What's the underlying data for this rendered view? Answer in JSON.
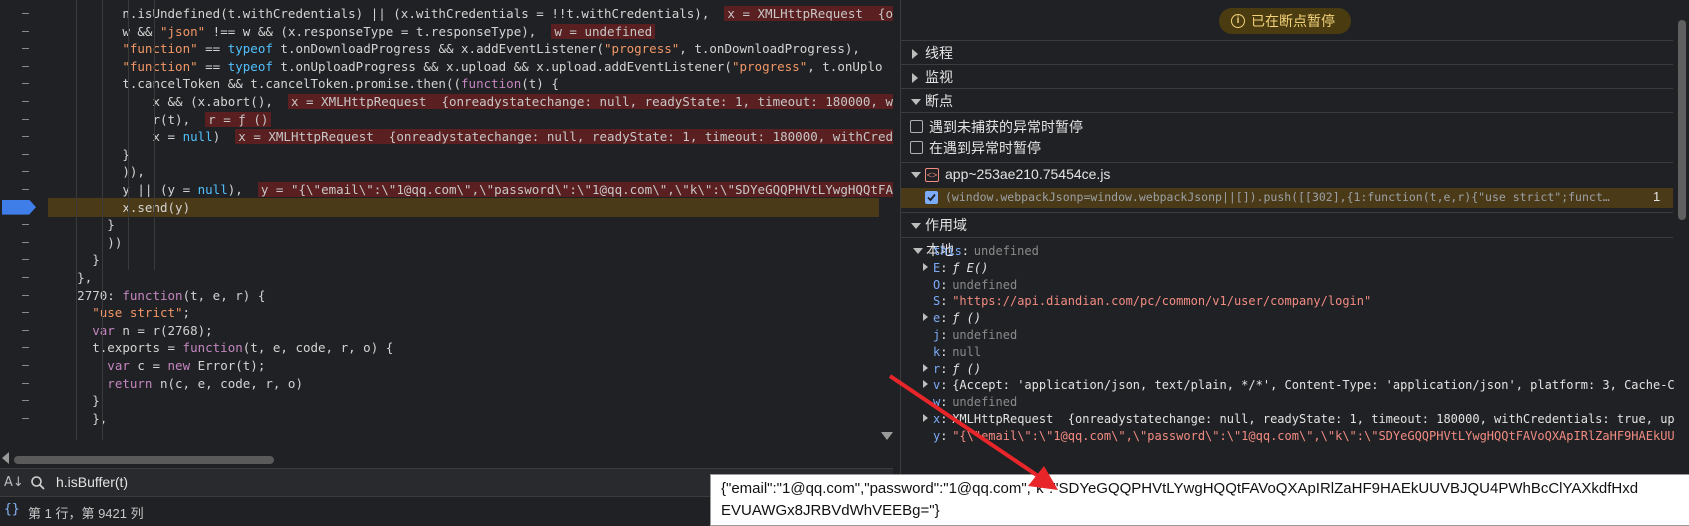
{
  "editor": {
    "lines": [
      {
        "indent": 6,
        "html": false,
        "code": "n.isUndefined(t.withCredentials) || (x.withCredentials = !!t.withCredentials),",
        "inline": "x = XMLHttpRequest  {o"
      },
      {
        "indent": 6,
        "code": "w && \"json\" !== w && (x.responseType = t.responseType),",
        "inline": "w = undefined"
      },
      {
        "indent": 6,
        "code": "\"function\" == typeof t.onDownloadProgress && x.addEventListener(\"progress\", t.onDownloadProgress),",
        "inline": ""
      },
      {
        "indent": 6,
        "code": "\"function\" == typeof t.onUploadProgress && x.upload && x.upload.addEventListener(\"progress\", t.onUplo",
        "inline": ""
      },
      {
        "indent": 6,
        "code": "t.cancelToken && t.cancelToken.promise.then((function(t) {",
        "inline": ""
      },
      {
        "indent": 8,
        "code": "x && (x.abort(),",
        "inline": "x = XMLHttpRequest  {onreadystatechange: null, readyState: 1, timeout: 180000, w"
      },
      {
        "indent": 8,
        "code": "r(t),",
        "inline": "r = ƒ ()"
      },
      {
        "indent": 8,
        "code": "x = null)",
        "inline": "x = XMLHttpRequest  {onreadystatechange: null, readyState: 1, timeout: 180000, withCred"
      },
      {
        "indent": 6,
        "code": "}",
        "inline": ""
      },
      {
        "indent": 6,
        "code": ")),",
        "inline": ""
      },
      {
        "indent": 6,
        "code": "y || (y = null),",
        "inline": "y = \"{\\\"email\\\":\\\"1@qq.com\\\",\\\"password\\\":\\\"1@qq.com\\\",\\\"k\\\":\\\"SDYeGQQPHVtLYwgHQQtFA"
      },
      {
        "indent": 6,
        "code": "x.send(y)",
        "inline": "",
        "current": true
      },
      {
        "indent": 5,
        "code": "}",
        "inline": ""
      },
      {
        "indent": 5,
        "code": "))",
        "inline": ""
      },
      {
        "indent": 4,
        "code": "}",
        "inline": ""
      },
      {
        "indent": 3,
        "code": "},",
        "inline": ""
      },
      {
        "indent": 3,
        "code": "2770: function(t, e, r) {",
        "inline": ""
      },
      {
        "indent": 4,
        "code": "\"use strict\";",
        "inline": ""
      },
      {
        "indent": 4,
        "code": "var n = r(2768);",
        "inline": ""
      },
      {
        "indent": 4,
        "code": "t.exports = function(t, e, code, r, o) {",
        "inline": ""
      },
      {
        "indent": 5,
        "code": "var c = new Error(t);",
        "inline": ""
      },
      {
        "indent": 5,
        "code": "return n(c, e, code, r, o)",
        "inline": ""
      },
      {
        "indent": 4,
        "code": "}",
        "inline": ""
      },
      {
        "indent": 4,
        "code": "},",
        "inline": ""
      }
    ]
  },
  "search": {
    "value": "h.isBuffer(t)"
  },
  "status": {
    "position": "第 1 行，第 9421 列"
  },
  "right": {
    "paused_badge": "已在断点暂停",
    "threads": "线程",
    "watch": "监视",
    "breakpoints": "断点",
    "pause_uncaught": "遇到未捕获的异常时暂停",
    "pause_caught": "在遇到异常时暂停",
    "file": "app~253ae210.75454ce.js",
    "bp_code": "(window.webpackJsonp=window.webpackJsonp||[]).push([[302],{1:function(t,e,r){\"use strict\";funct…",
    "bp_line": "1",
    "scope": "作用域",
    "local": "本地",
    "vars": [
      {
        "name": "this",
        "val": "undefined",
        "type": "u",
        "expand": false
      },
      {
        "name": "E",
        "val": "ƒ E()",
        "type": "f",
        "expand": true
      },
      {
        "name": "O",
        "val": "undefined",
        "type": "u",
        "expand": false
      },
      {
        "name": "S",
        "val": "\"https://api.diandian.com/pc/common/v1/user/company/login\"",
        "type": "s",
        "expand": false
      },
      {
        "name": "e",
        "val": "ƒ ()",
        "type": "f",
        "expand": true
      },
      {
        "name": "j",
        "val": "undefined",
        "type": "u",
        "expand": false
      },
      {
        "name": "k",
        "val": "null",
        "type": "u",
        "expand": false
      },
      {
        "name": "r",
        "val": "ƒ ()",
        "type": "f",
        "expand": true
      },
      {
        "name": "v",
        "val": "{Accept: 'application/json, text/plain, */*', Content-Type: 'application/json', platform: 3, Cache-Con",
        "type": "o",
        "expand": true
      },
      {
        "name": "w",
        "val": "undefined",
        "type": "u",
        "expand": false
      },
      {
        "name": "x",
        "val": "XMLHttpRequest  {onreadystatechange: null, readyState: 1, timeout: 180000, withCredentials: true, uplo",
        "type": "o",
        "expand": true
      },
      {
        "name": "y",
        "val": "\"{\\\"email\\\":\\\"1@qq.com\\\",\\\"password\\\":\\\"1@qq.com\\\",\\\"k\\\":\\\"SDYeGQQPHVtLYwgHQQtFAVoQXApIRlZaHF9HAEkUUVB",
        "type": "s",
        "expand": false
      }
    ]
  },
  "tooltip": {
    "line1": "{\"email\":\"1@qq.com\",\"password\":\"1@qq.com\",\"k\":\"SDYeGQQPHVtLYwgHQQtFAVoQXApIRlZaHF9HAEkUUVBJQU4PWhBcClYAXkdfHxd",
    "line2": "EVUAWGx8JRBVdWhVEEBg=\"}"
  },
  "colors": {
    "annotation_arrow": "#e8262a",
    "breakpoint": "#3f7de8",
    "paused_badge_bg": "#4a3b10"
  }
}
